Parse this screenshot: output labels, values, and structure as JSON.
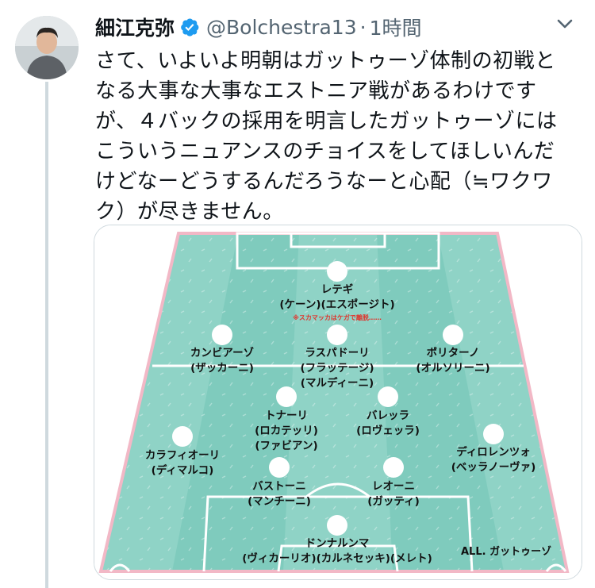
{
  "tweet": {
    "author_name": "細江克弥",
    "handle": "@Bolchestra13",
    "separator": "·",
    "time": "1時間",
    "verified": true,
    "text": "さて、いよいよ明朝はガットゥーゾ体制の初戦となる大事な大事なエストニア戦があるわけですが、４バックの採用を明言したガットゥーゾにはこういうニュアンスのチョイスをしてほしいんだけどなーどうするんだろうなーと心配（≒ワクワク）が尽きません。"
  },
  "icons": {
    "verified": "verified-badge-icon",
    "more": "more-options-icon",
    "avatar": "avatar"
  },
  "colors": {
    "pitch_light": "#8fd3c6",
    "pitch_dark": "#7cc8ba",
    "pitch_border": "#f2b8c6",
    "verified": "#1d9bf0"
  },
  "formation": {
    "players": [
      {
        "id": "gk",
        "lines": [
          "ドンナルンマ",
          "(ヴィカーリオ)(カルネセッキ)(メレト)"
        ]
      },
      {
        "id": "lb",
        "lines": [
          "カラフィオーリ",
          "(ディマルコ)"
        ]
      },
      {
        "id": "lcb",
        "lines": [
          "バストーニ",
          "(マンチーニ)"
        ]
      },
      {
        "id": "rcb",
        "lines": [
          "レオーニ",
          "(ガッティ)"
        ]
      },
      {
        "id": "rb",
        "lines": [
          "ディロレンツォ",
          "(ベッラノーヴァ)"
        ]
      },
      {
        "id": "lcm",
        "lines": [
          "トナーリ",
          "(ロカテッリ)",
          "(ファビアン)"
        ]
      },
      {
        "id": "rcm",
        "lines": [
          "バレッラ",
          "(ロヴェッラ)"
        ]
      },
      {
        "id": "lw",
        "lines": [
          "カンビアーゾ",
          "(ザッカーニ)"
        ]
      },
      {
        "id": "am",
        "lines": [
          "ラスパドーリ",
          "(フラッテージ)",
          "(マルディーニ)"
        ]
      },
      {
        "id": "rw",
        "lines": [
          "ポリターノ",
          "(オルソリーニ)"
        ]
      },
      {
        "id": "st",
        "lines": [
          "レテギ",
          "(ケーン)(エスポージト)"
        ]
      }
    ],
    "injury_note": "※スカマッカはケガで離脱……",
    "coach_label": "ALL. ガットゥーゾ"
  }
}
